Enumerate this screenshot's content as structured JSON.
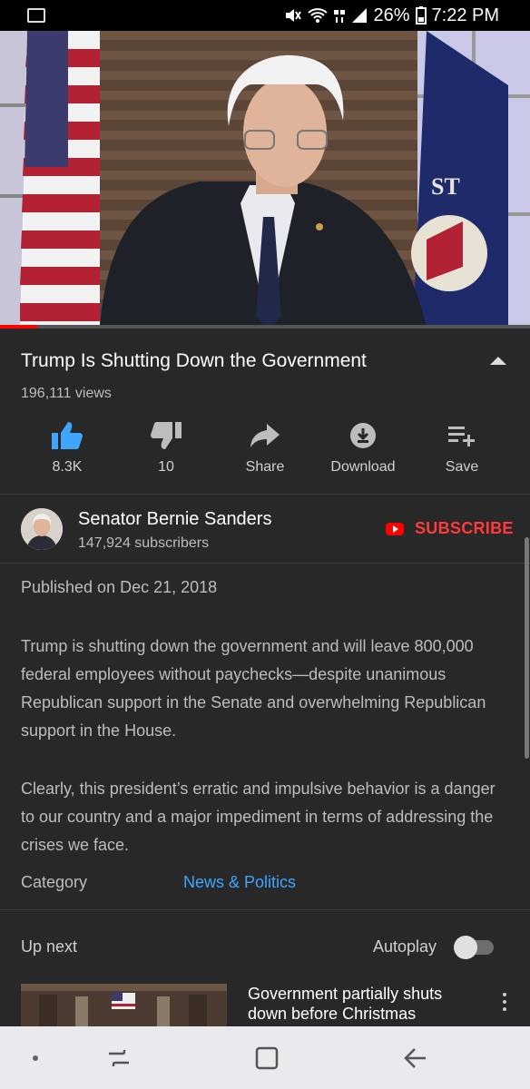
{
  "status_bar": {
    "battery": "26%",
    "time": "7:22 PM"
  },
  "video": {
    "progress_fraction": 0.07
  },
  "info": {
    "title": "Trump Is Shutting Down the Government",
    "views": "196,111 views"
  },
  "actions": [
    {
      "label": "8.3K",
      "icon": "thumbs-up-icon"
    },
    {
      "label": "10",
      "icon": "thumbs-down-icon"
    },
    {
      "label": "Share",
      "icon": "share-icon"
    },
    {
      "label": "Download",
      "icon": "download-icon"
    },
    {
      "label": "Save",
      "icon": "playlist-add-icon"
    }
  ],
  "channel": {
    "name": "Senator Bernie Sanders",
    "subscribers": "147,924 subscribers",
    "subscribe_label": "SUBSCRIBE"
  },
  "description": {
    "published": "Published on Dec 21, 2018",
    "paragraph1": "Trump is shutting down the government and will leave 800,000 federal employees without paychecks—despite unanimous Republican support in the Senate and overwhelming Republican support in the House.",
    "paragraph2": "Clearly, this president’s erratic and impulsive behavior is a danger to our country and a major impediment in terms of addressing the crises we face.",
    "category_label": "Category",
    "category_value": "News & Politics"
  },
  "up_next": {
    "label": "Up next",
    "autoplay_label": "Autoplay",
    "autoplay_on": false,
    "next_title": "Government partially shuts down before Christmas"
  },
  "colors": {
    "accent": "#ff0000",
    "link": "#3ea6ff",
    "like_active": "#3ea6ff",
    "background": "#282828"
  }
}
